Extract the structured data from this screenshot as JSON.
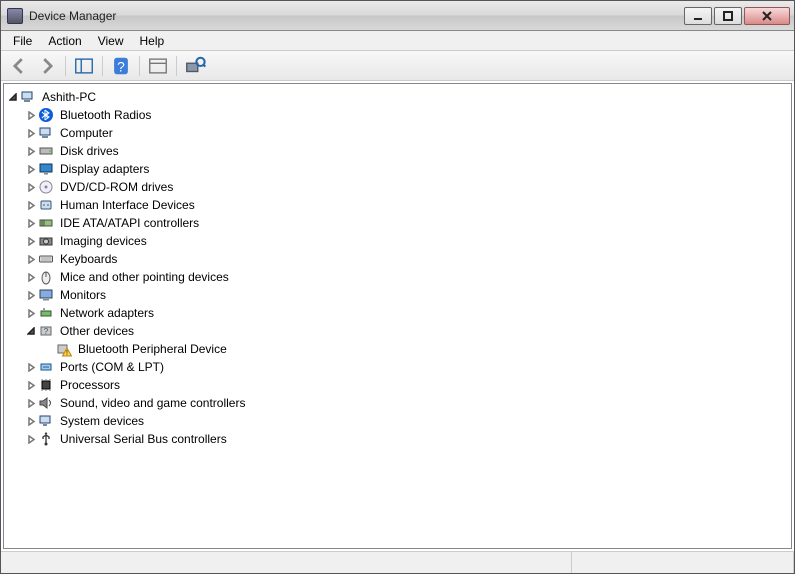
{
  "window": {
    "title": "Device Manager"
  },
  "menu": {
    "items": [
      "File",
      "Action",
      "View",
      "Help"
    ]
  },
  "toolbar": {
    "buttons": [
      "back",
      "forward",
      "sep",
      "show-hide-tree",
      "sep",
      "help",
      "sep",
      "action-1",
      "sep",
      "scan"
    ]
  },
  "tree": {
    "root": {
      "label": "Ashith-PC",
      "icon": "computer",
      "expanded": true
    },
    "children": [
      {
        "label": "Bluetooth Radios",
        "icon": "bluetooth"
      },
      {
        "label": "Computer",
        "icon": "computer"
      },
      {
        "label": "Disk drives",
        "icon": "disk"
      },
      {
        "label": "Display adapters",
        "icon": "display"
      },
      {
        "label": "DVD/CD-ROM drives",
        "icon": "cd"
      },
      {
        "label": "Human Interface Devices",
        "icon": "hid"
      },
      {
        "label": "IDE ATA/ATAPI controllers",
        "icon": "ide"
      },
      {
        "label": "Imaging devices",
        "icon": "imaging"
      },
      {
        "label": "Keyboards",
        "icon": "keyboard"
      },
      {
        "label": "Mice and other pointing devices",
        "icon": "mouse"
      },
      {
        "label": "Monitors",
        "icon": "monitor"
      },
      {
        "label": "Network adapters",
        "icon": "network"
      },
      {
        "label": "Other devices",
        "icon": "other",
        "expanded": true,
        "children": [
          {
            "label": "Bluetooth Peripheral Device",
            "icon": "warning",
            "leaf": true
          }
        ]
      },
      {
        "label": "Ports (COM & LPT)",
        "icon": "port"
      },
      {
        "label": "Processors",
        "icon": "cpu"
      },
      {
        "label": "Sound, video and game controllers",
        "icon": "sound"
      },
      {
        "label": "System devices",
        "icon": "system"
      },
      {
        "label": "Universal Serial Bus controllers",
        "icon": "usb"
      }
    ]
  }
}
